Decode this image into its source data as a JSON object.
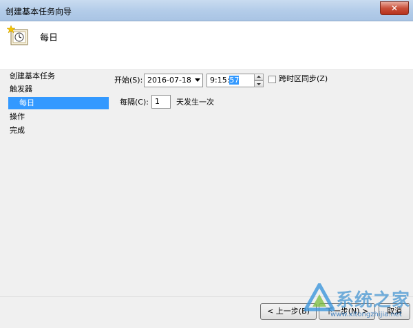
{
  "window": {
    "title": "创建基本任务向导",
    "close_glyph": "✕"
  },
  "header": {
    "title": "每日",
    "icon": "task-clock-icon"
  },
  "sidebar": {
    "items": [
      {
        "label": "创建基本任务"
      },
      {
        "label": "触发器"
      },
      {
        "label": "每日",
        "selected": true
      },
      {
        "label": "操作"
      },
      {
        "label": "完成"
      }
    ]
  },
  "form": {
    "start_label": "开始(S):",
    "start_date": "2016-07-18",
    "start_time_prefix": "9:15:",
    "start_time_seconds": "57",
    "sync_timezone_label": "跨时区同步(Z)",
    "sync_timezone_checked": false,
    "recur_label": "每隔(C):",
    "recur_value": "1",
    "recur_suffix": "天发生一次"
  },
  "buttons": {
    "back_label": "< 上一步(B)",
    "next_label": "下一步(N) >",
    "cancel_label": "取消"
  },
  "watermark": {
    "text": "系统之家",
    "url": "www.xitongzhijia.net"
  },
  "colors": {
    "selection": "#3399ff",
    "titlebar": "#b4cde9"
  }
}
